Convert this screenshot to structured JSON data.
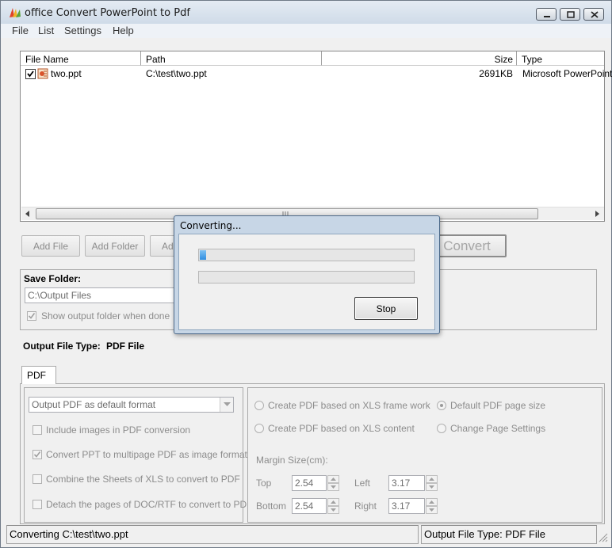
{
  "window": {
    "title": "office Convert PowerPoint to Pdf"
  },
  "menu": {
    "items": [
      "File",
      "List",
      "Settings",
      "Help"
    ]
  },
  "file_list": {
    "columns": [
      "File Name",
      "Path",
      "Size",
      "Type"
    ],
    "rows": [
      {
        "checked": true,
        "name": "two.ppt",
        "path": "C:\\test\\two.ppt",
        "size": "2691KB",
        "type": "Microsoft PowerPoint"
      }
    ]
  },
  "toolbar": {
    "add_file": "Add File",
    "add_folder": "Add Folder",
    "add_partial": "Ad",
    "convert": "Convert"
  },
  "save_folder": {
    "title": "Save Folder:",
    "path": "C:\\Output Files",
    "show_when_done": "Show output folder when done",
    "show_when_done_checked": true
  },
  "output_type": {
    "label": "Output File Type:",
    "value": "PDF File"
  },
  "tabs": {
    "pdf": "PDF"
  },
  "pdf_options": {
    "format_selected": "Output PDF as default format",
    "include_images": "Include images in PDF conversion",
    "convert_ppt_multipage": "Convert PPT to multipage PDF as image format",
    "convert_ppt_multipage_checked": true,
    "combine_sheets": "Combine the Sheets of XLS to convert to PDF",
    "detach_pages": "Detach the pages of DOC/RTF to convert to PDF"
  },
  "page_options": {
    "xls_frame": "Create PDF based on XLS frame work",
    "xls_content": "Create PDF based on XLS content",
    "default_size": "Default PDF page size",
    "default_size_selected": true,
    "change_settings": "Change Page Settings",
    "margin_title": "Margin Size(cm):",
    "top_label": "Top",
    "top_value": "2.54",
    "left_label": "Left",
    "left_value": "3.17",
    "bottom_label": "Bottom",
    "bottom_value": "2.54",
    "right_label": "Right",
    "right_value": "3.17"
  },
  "status": {
    "left": "Converting  C:\\test\\two.ppt",
    "right": "Output File Type:  PDF File"
  },
  "dialog": {
    "title": "Converting...",
    "progress_primary": 0.03,
    "progress_secondary": 0,
    "stop": "Stop"
  },
  "colors": {
    "accent": "#2f8ee0",
    "titlebar": "#cfdbe8"
  }
}
